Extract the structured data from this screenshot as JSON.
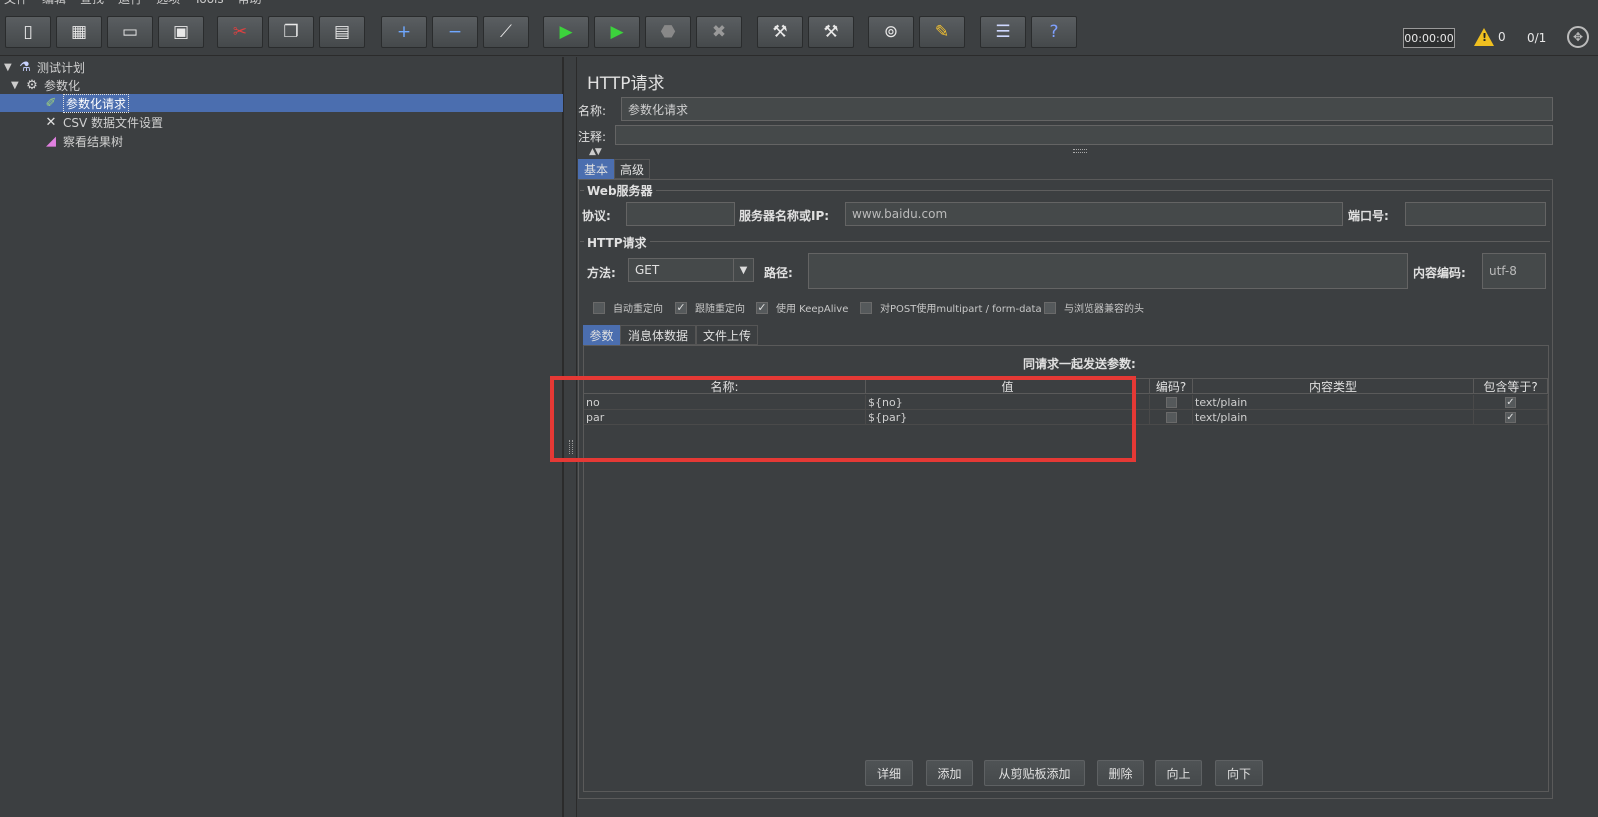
{
  "menu": [
    "文件",
    "编辑",
    "查找",
    "运行",
    "选项",
    "Tools",
    "帮助"
  ],
  "toolbar": {
    "buttons": [
      {
        "name": "new-icon",
        "glyph": "▯"
      },
      {
        "name": "templates-icon",
        "glyph": "▦"
      },
      {
        "name": "open-icon",
        "glyph": "▭"
      },
      {
        "name": "save-icon",
        "glyph": "▣"
      },
      {
        "name": "cut-icon",
        "glyph": "✂"
      },
      {
        "name": "copy-icon",
        "glyph": "❐"
      },
      {
        "name": "paste-icon",
        "glyph": "▤"
      },
      {
        "name": "expand-icon",
        "glyph": "+"
      },
      {
        "name": "collapse-icon",
        "glyph": "−"
      },
      {
        "name": "toggle-icon",
        "glyph": "⟋"
      },
      {
        "name": "start-icon",
        "glyph": "▶"
      },
      {
        "name": "start-no-pauses-icon",
        "glyph": "▶"
      },
      {
        "name": "stop-icon",
        "glyph": "⬣"
      },
      {
        "name": "shutdown-icon",
        "glyph": "✖"
      },
      {
        "name": "clear-icon",
        "glyph": "⚒"
      },
      {
        "name": "clear-all-icon",
        "glyph": "⚒"
      },
      {
        "name": "search-icon",
        "glyph": "⊚"
      },
      {
        "name": "reset-search-icon",
        "glyph": "✎"
      },
      {
        "name": "function-helper-icon",
        "glyph": "☰"
      },
      {
        "name": "help-icon",
        "glyph": "?"
      }
    ],
    "timer": "00:00:00",
    "warning_count": "0",
    "threads": "0/1"
  },
  "tree": [
    {
      "label": "测试计划",
      "icon": "flask-icon",
      "glyph": "⚗",
      "arrow": "▼"
    },
    {
      "label": "参数化",
      "icon": "thread-group-icon",
      "glyph": "⚙",
      "arrow": "▼"
    },
    {
      "label": "参数化请求",
      "icon": "sampler-icon",
      "glyph": "✐",
      "arrow": ""
    },
    {
      "label": "CSV 数据文件设置",
      "icon": "config-icon",
      "glyph": "✕",
      "arrow": ""
    },
    {
      "label": "察看结果树",
      "icon": "listener-icon",
      "glyph": "◢",
      "arrow": ""
    }
  ],
  "panel": {
    "title": "HTTP请求",
    "name_label": "名称:",
    "name_value": "参数化请求",
    "comment_label": "注释:",
    "comment_value": "",
    "tabs": [
      "基本",
      "高级"
    ],
    "web_server": {
      "group_title": "Web服务器",
      "protocol_label": "协议:",
      "protocol_value": "",
      "server_label": "服务器名称或IP:",
      "server_value": "www.baidu.com",
      "port_label": "端口号:",
      "port_value": ""
    },
    "http_request": {
      "group_title": "HTTP请求",
      "method_label": "方法:",
      "method_value": "GET",
      "path_label": "路径:",
      "path_value": "",
      "encoding_label": "内容编码:",
      "encoding_value": "utf-8"
    },
    "options": [
      {
        "label": "自动重定向",
        "checked": false
      },
      {
        "label": "跟随重定向",
        "checked": true
      },
      {
        "label": "使用 KeepAlive",
        "checked": true
      },
      {
        "label": "对POST使用multipart / form-data",
        "checked": false
      },
      {
        "label": "与浏览器兼容的头",
        "checked": false
      }
    ],
    "sub_tabs": [
      "参数",
      "消息体数据",
      "文件上传"
    ],
    "params_caption": "同请求一起发送参数:",
    "columns": [
      "名称:",
      "值",
      "编码?",
      "内容类型",
      "包含等于?"
    ],
    "rows": [
      {
        "name": "no",
        "value": "${no}",
        "encode": false,
        "content_type": "text/plain",
        "include_equals": true
      },
      {
        "name": "par",
        "value": "${par}",
        "encode": false,
        "content_type": "text/plain",
        "include_equals": true
      }
    ],
    "buttons": [
      "详细",
      "添加",
      "从剪贴板添加",
      "删除",
      "向上",
      "向下"
    ]
  },
  "colors": {
    "highlight_box": "#e53935",
    "selection": "#4b6eaf"
  }
}
